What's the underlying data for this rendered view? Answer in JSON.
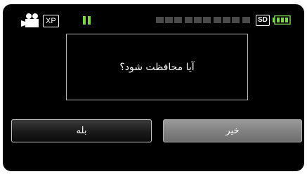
{
  "status": {
    "mode_icon": "video-camera-icon",
    "mode_label": "XP",
    "pause_icon": "pause-icon",
    "storage_label": "SD",
    "battery_icon": "battery-full-icon"
  },
  "dialog": {
    "message": "آیا محافظت شود؟"
  },
  "buttons": {
    "yes_label": "بله",
    "no_label": "خیر"
  },
  "colors": {
    "background": "#000000",
    "accent_green": "#7fd34e",
    "selected_button": "#8a8a8a"
  }
}
